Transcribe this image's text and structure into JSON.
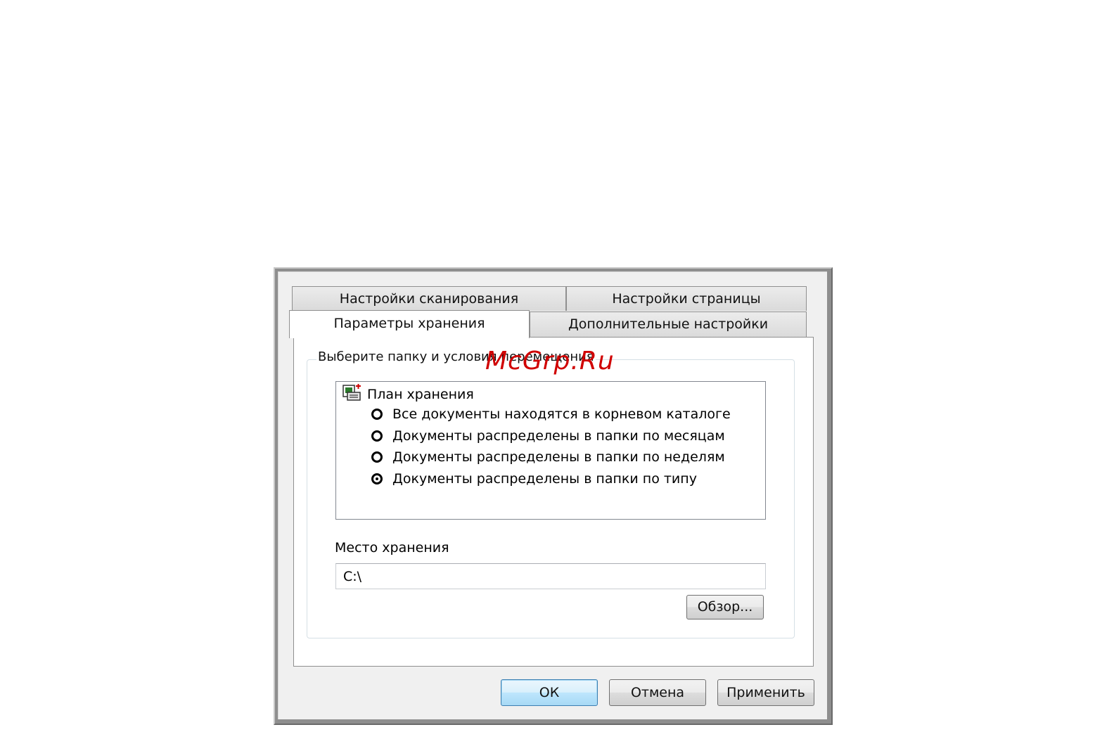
{
  "dialog": {
    "tabs_row1": [
      {
        "label": "Настройки сканирования"
      },
      {
        "label": "Настройки страницы"
      }
    ],
    "tabs_row2": [
      {
        "label": "Параметры хранения",
        "active": true
      },
      {
        "label": "Дополнительные настройки"
      }
    ],
    "group_title": "Выберите папку и условия перемещения",
    "tree": {
      "root_label": "План хранения",
      "root_icon": "storage-plan-icon",
      "options": [
        {
          "label": "Все документы находятся в корневом каталоге",
          "checked": false
        },
        {
          "label": "Документы распределены в папки по месяцам",
          "checked": false
        },
        {
          "label": "Документы распределены в папки по неделям",
          "checked": false
        },
        {
          "label": "Документы распределены в папки по типу",
          "checked": true
        }
      ]
    },
    "location_label": "Место хранения",
    "location_value": "C:\\",
    "browse_label": "Обзор...",
    "ok_label": "ОК",
    "cancel_label": "Отмена",
    "apply_label": "Применить"
  },
  "watermark": "McGrp.Ru",
  "colors": {
    "watermark": "#d00000",
    "default_button_border": "#3c7fb1"
  }
}
